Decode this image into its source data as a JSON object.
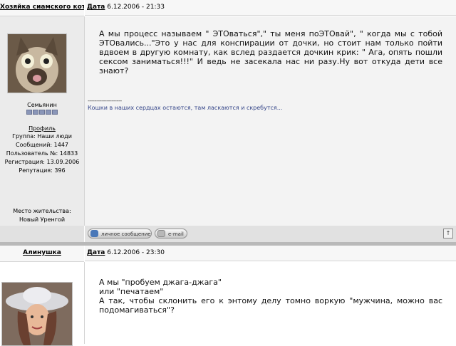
{
  "post1": {
    "author": "Хозяйка сиамского кота",
    "date_label": "Дата",
    "date_value": "6.12.2006 - 21:33",
    "avatar_desc": "cat-avatar",
    "rank_title": "Семьянин",
    "rank_stars": 5,
    "profile_link": "Профиль",
    "group": "Группа: Наши люди",
    "messages": "Сообщений: 1447",
    "user_no": "Пользователь №: 14833",
    "registration": "Регистрация: 13.09.2006",
    "reputation": "Репутация: 396",
    "location_label": "Место жительства:",
    "location_value": "Новый Уренгой",
    "body": "А мы процесс называем \" ЭТОваться\",\" ты меня поЭТОвай\", \" когда мы с тобой ЭТОвались...\"Это у нас для конспирации от дочки, но стоит нам только пойти вдвоем в другую комнату, как вслед раздается дочкин крик: \" Ага, опять пошли сексом заниматься!!!\" И ведь не засекала нас ни разу.Ну вот откуда дети все знают?",
    "signature_line": "--------------------",
    "signature": "Кошки в наших сердцах остаются, там ласкаются и скребутся...",
    "buttons": {
      "pm": "личное сообщение",
      "mail": "e-mail",
      "top": "↑"
    }
  },
  "post2": {
    "author": "Алинушка",
    "date_label": "Дата",
    "date_value": "6.12.2006 - 23:30",
    "body_line1": "А мы \"пробуем джага-джага\"",
    "body_line2": "или \"печатаем\"",
    "body_line3": "А так, чтобы склонить его к энтому делу томно воркую \"мужчина, можно вас подомагиваться\"?"
  }
}
